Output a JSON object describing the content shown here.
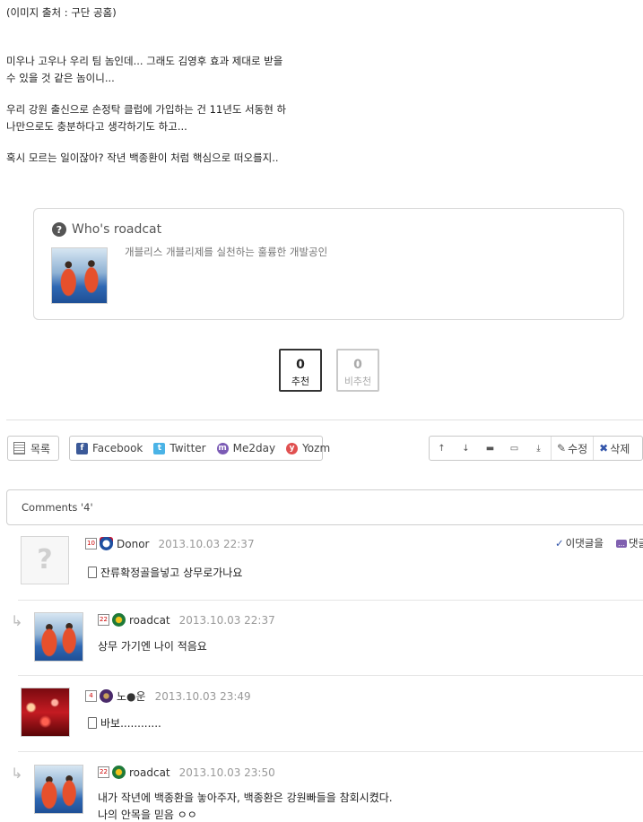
{
  "post": {
    "lines": [
      "(이미지 출처 : 구단 공홈)",
      "미우나 고우나 우리 팀 놈인데... 그래도 김영후 효과 제대로 받을",
      "수 있을 것 같은 놈이니...",
      "우리 강원 출신으로 손정탁 클럽에 가입하는 건 11년도 서동현 하",
      "나만으로도 충분하다고 생각하기도 하고...",
      "혹시 모르는 일이잖아? 작년 백종환이 처럼 핵심으로 떠오를지.."
    ]
  },
  "author": {
    "title": "Who's roadcat",
    "description": "개블리스 개블리제를 실천하는 훌륭한 개발공인",
    "icon": "question-icon"
  },
  "votes": {
    "up": {
      "count": "0",
      "label": "추천"
    },
    "down": {
      "count": "0",
      "label": "비추천"
    }
  },
  "toolbar": {
    "list_label": "목록",
    "share": [
      "Facebook",
      "Twitter",
      "Me2day",
      "Yozm"
    ],
    "edit_label": "수정",
    "delete_label": "삭제"
  },
  "comments": {
    "header": "Comments '4'",
    "items": [
      {
        "level": "10",
        "author": "Donor",
        "date": "2013.10.03 22:37",
        "text": "잔류확정골을넣고 상무로가나요",
        "reply_action": "이댓글을",
        "comment_action": "댓글"
      },
      {
        "level": "22",
        "author": "roadcat",
        "date": "2013.10.03 22:37",
        "text": "상무 가기엔 나이 적음요"
      },
      {
        "level": "4",
        "author": "노●운",
        "date": "2013.10.03 23:49",
        "text": "바보............"
      },
      {
        "level": "22",
        "author": "roadcat",
        "date": "2013.10.03 23:50",
        "text": "내가 작년에 백종환을 놓아주자, 백종환은 강원빠들을 참회시켰다.",
        "text2": "나의 안목을 믿음 ㅇㅇ"
      }
    ]
  },
  "colors": {
    "facebook": "#3b5998",
    "twitter": "#4ab3e6",
    "me2day": "#7b5bb5",
    "yozm": "#e05050",
    "delete": "#3355aa"
  }
}
